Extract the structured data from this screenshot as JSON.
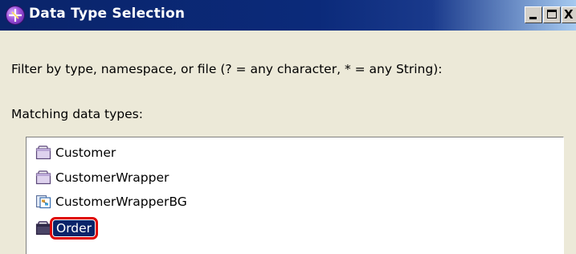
{
  "window": {
    "title": "Data Type Selection",
    "title_icon": "wid-app-icon",
    "controls": {
      "minimize": "minimize-icon",
      "maximize": "maximize-icon",
      "close_glyph": "X"
    }
  },
  "filter": {
    "label": "Filter by type, namespace, or file (? = any character, * = any String):"
  },
  "matching": {
    "label": "Matching data types:",
    "items": [
      {
        "label": "Customer",
        "icon": "business-object-icon",
        "selected": false
      },
      {
        "label": "CustomerWrapper",
        "icon": "business-object-icon",
        "selected": false
      },
      {
        "label": "CustomerWrapperBG",
        "icon": "business-graph-icon",
        "selected": false
      },
      {
        "label": "Order",
        "icon": "business-object-icon",
        "selected": true
      }
    ]
  },
  "colors": {
    "titlebar": "#0a246a",
    "selection": "#0a246a",
    "highlight_ring": "#e00000",
    "dialog_bg": "#ece9d8"
  }
}
